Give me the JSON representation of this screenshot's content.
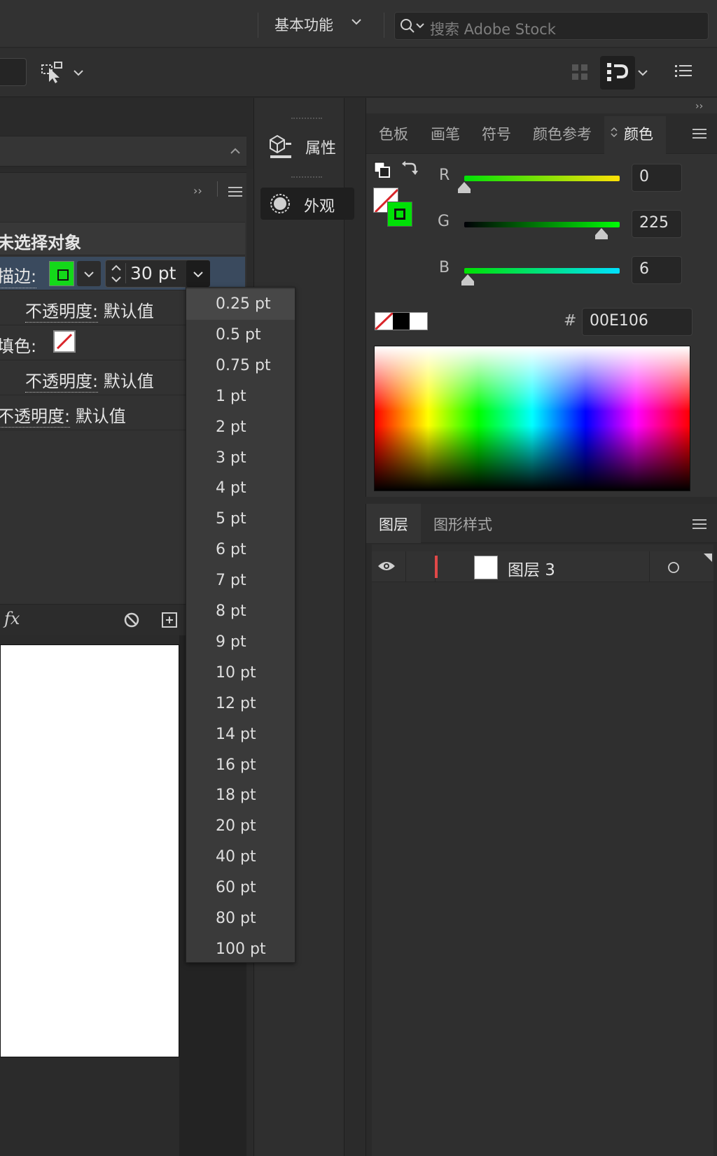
{
  "topbar": {
    "workspace_label": "基本功能",
    "search_placeholder": "搜索 Adobe Stock"
  },
  "middle_column": {
    "properties_label": "属性",
    "appearance_label": "外观"
  },
  "appearance_panel": {
    "selection_title": "未选择对象",
    "stroke_label": "描边:",
    "stroke_weight": "30 pt",
    "stroke_opacity_label": "不透明度:",
    "stroke_opacity_value": "默认值",
    "fill_label": "填色:",
    "fill_opacity_label": "不透明度:",
    "fill_opacity_value": "默认值",
    "object_opacity_label": "不透明度:",
    "object_opacity_value": "默认值",
    "fx_label": "fx"
  },
  "stroke_weight_menu": {
    "items": [
      "0.25 pt",
      "0.5 pt",
      "0.75 pt",
      "1 pt",
      "2 pt",
      "3 pt",
      "4 pt",
      "5 pt",
      "6 pt",
      "7 pt",
      "8 pt",
      "9 pt",
      "10 pt",
      "12 pt",
      "14 pt",
      "16 pt",
      "18 pt",
      "20 pt",
      "40 pt",
      "60 pt",
      "80 pt",
      "100 pt"
    ],
    "highlighted": "0.25 pt"
  },
  "color_panel": {
    "tabs": [
      "色板",
      "画笔",
      "符号",
      "颜色参考",
      "颜色"
    ],
    "active_tab": "颜色",
    "sliders": [
      {
        "label": "R",
        "value": "0",
        "fraction": 0.0
      },
      {
        "label": "G",
        "value": "225",
        "fraction": 0.882
      },
      {
        "label": "B",
        "value": "6",
        "fraction": 0.024
      }
    ],
    "hex_label": "#",
    "hex_value": "00E106",
    "colors": {
      "stroke": "#00e106",
      "none_slash": "#d9252a"
    }
  },
  "layers_panel": {
    "tabs": [
      "图层",
      "图形样式"
    ],
    "active_tab": "图层",
    "layers": [
      {
        "name": "图层 3",
        "color": "#e04848"
      }
    ]
  }
}
